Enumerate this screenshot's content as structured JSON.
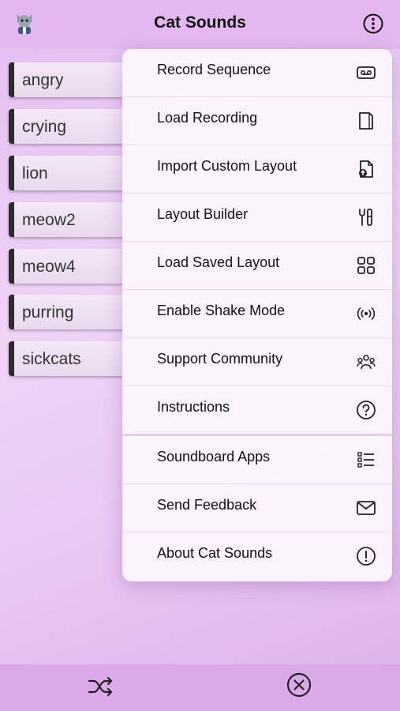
{
  "header": {
    "title": "Cat Sounds",
    "avatar_icon": "cat-avatar-icon",
    "more_icon": "more-vertical-icon"
  },
  "sounds": [
    {
      "label": "angry"
    },
    {
      "label": "crying"
    },
    {
      "label": "lion"
    },
    {
      "label": "meow2"
    },
    {
      "label": "meow4"
    },
    {
      "label": "purring"
    },
    {
      "label": "sickcats"
    }
  ],
  "menu": {
    "items": [
      {
        "label": "Record Sequence",
        "icon": "cassette-icon"
      },
      {
        "label": "Load Recording",
        "icon": "document-icon"
      },
      {
        "label": "Import Custom Layout",
        "icon": "import-file-icon"
      },
      {
        "label": "Layout Builder",
        "icon": "tools-icon"
      },
      {
        "label": "Load Saved Layout",
        "icon": "grid-icon"
      },
      {
        "label": "Enable Shake Mode",
        "icon": "broadcast-icon"
      },
      {
        "label": "Support Community",
        "icon": "community-icon"
      },
      {
        "label": "Instructions",
        "icon": "help-icon"
      },
      {
        "label": "Soundboard Apps",
        "icon": "list-icon"
      },
      {
        "label": "Send Feedback",
        "icon": "mail-icon"
      },
      {
        "label": "About Cat Sounds",
        "icon": "info-icon"
      }
    ]
  },
  "bottom_bar": {
    "shuffle_icon": "shuffle-icon",
    "close_icon": "close-circle-icon"
  },
  "colors": {
    "header": "#e4b7f0",
    "bottom_bar": "#dba9ea",
    "menu_background": "#fcf4fd",
    "button_border": "#2c2c2c"
  }
}
